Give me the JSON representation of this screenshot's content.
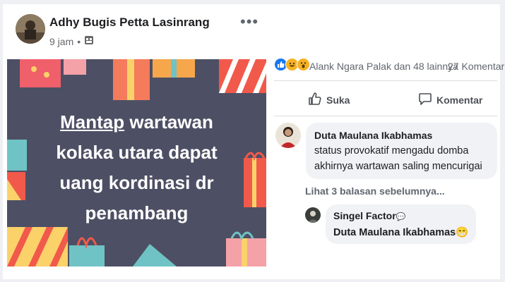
{
  "post": {
    "author": "Adhy Bugis Petta Lasinrang",
    "time": "9 jam",
    "separator": "•",
    "more_glyph": "•••",
    "image_text": {
      "word1": "Mantap",
      "rest1": " wartawan",
      "line2": "kolaka utara dapat",
      "line3": "uang kordinasi dr",
      "line4": "penambang"
    }
  },
  "reactions": {
    "icons": [
      "like-icon",
      "haha-icon",
      "wow-icon"
    ],
    "text": "Alank Ngara Palak dan 48 lainnya",
    "comments": "27 Komentar"
  },
  "actions": {
    "like": "Suka",
    "comment": "Komentar"
  },
  "comments": [
    {
      "name": "Duta Maulana Ikabhamas",
      "line1": "status provokatif mengadu domba",
      "line2": "akhirnya wartawan saling mencurigai"
    }
  ],
  "replies_link": "Lihat 3 balasan sebelumnya...",
  "reply": {
    "name": "Singel Factor",
    "name_emoji": "💬",
    "text": "Duta Maulana Ikabhamas",
    "emoji": "😁"
  },
  "colors": {
    "image_bg": "#4d5064",
    "text": "#1c1e21",
    "secondary": "#65676b",
    "bubble": "#f0f2f5"
  }
}
